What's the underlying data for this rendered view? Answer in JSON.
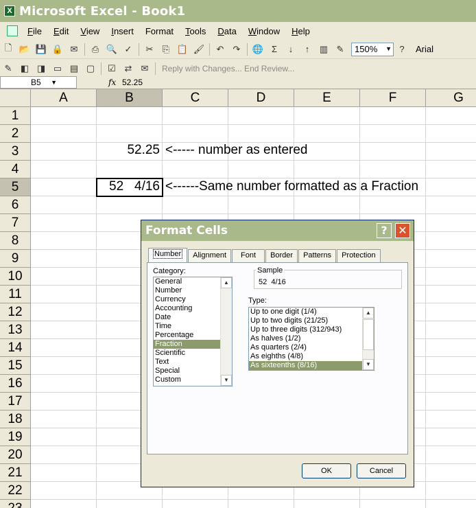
{
  "window": {
    "title": "Microsoft Excel - Book1"
  },
  "menu": [
    {
      "key": "F",
      "rest": "ile"
    },
    {
      "key": "E",
      "rest": "dit"
    },
    {
      "key": "V",
      "rest": "iew"
    },
    {
      "key": "I",
      "rest": "nsert"
    },
    {
      "key": "",
      "rest": "Format"
    },
    {
      "key": "T",
      "rest": "ools"
    },
    {
      "key": "D",
      "rest": "ata"
    },
    {
      "key": "W",
      "rest": "indow"
    },
    {
      "key": "H",
      "rest": "elp"
    }
  ],
  "toolbar": {
    "zoom": "150%",
    "font": "Arial",
    "review_text": "Reply with Changes...   End Review..."
  },
  "formula_bar": {
    "name_box": "B5",
    "fx": "fx",
    "value": "52.25"
  },
  "columns": [
    "A",
    "B",
    "C",
    "D",
    "E",
    "F",
    "G"
  ],
  "rows": [
    "1",
    "2",
    "3",
    "4",
    "5",
    "6",
    "7",
    "8",
    "9",
    "10",
    "11",
    "12",
    "13",
    "14",
    "15",
    "16",
    "17",
    "18",
    "19",
    "20",
    "21",
    "22",
    "23"
  ],
  "cells": {
    "b3": "52.25",
    "c3": "<----- number as entered",
    "b5": "52   4/16",
    "c5": "<------Same number formatted as a Fraction"
  },
  "dialog": {
    "title": "Format Cells",
    "help": "?",
    "close": "✕",
    "tabs": [
      "Number",
      "Alignment",
      "Font",
      "Border",
      "Patterns",
      "Protection"
    ],
    "category_label": "Category:",
    "categories": [
      "General",
      "Number",
      "Currency",
      "Accounting",
      "Date",
      "Time",
      "Percentage",
      "Fraction",
      "Scientific",
      "Text",
      "Special",
      "Custom"
    ],
    "selected_category": "Fraction",
    "sample_label": "Sample",
    "sample_value": "52  4/16",
    "type_label": "Type:",
    "types": [
      "Up to one digit (1/4)",
      "Up to two digits (21/25)",
      "Up to three digits (312/943)",
      "As halves (1/2)",
      "As quarters (2/4)",
      "As eighths (4/8)",
      "As sixteenths (8/16)"
    ],
    "selected_type": "As sixteenths (8/16)",
    "ok": "OK",
    "cancel": "Cancel"
  }
}
